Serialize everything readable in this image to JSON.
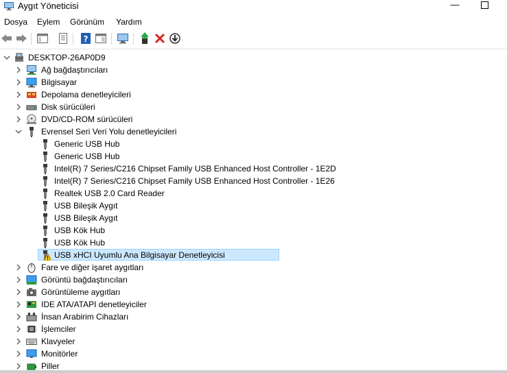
{
  "window": {
    "title": "Aygıt Yöneticisi",
    "minimize_glyph": "—"
  },
  "menu": [
    "Dosya",
    "Eylem",
    "Görünüm",
    "Yardım"
  ],
  "toolbar": {
    "icons": [
      "back-arrow-icon",
      "forward-arrow-icon",
      "show-hide-console-tree-icon",
      "properties-icon",
      "help-icon",
      "action-pane-icon",
      "scan-hardware-icon",
      "update-driver-icon",
      "uninstall-icon",
      "disable-device-icon"
    ]
  },
  "tree": {
    "root": "DESKTOP-26AP0D9",
    "categories_before": [
      {
        "label": "Ağ bağdaştırıcıları",
        "icon": "network-adapter-icon"
      },
      {
        "label": "Bilgisayar",
        "icon": "computer-icon"
      },
      {
        "label": "Depolama denetleyicileri",
        "icon": "storage-controller-icon"
      },
      {
        "label": "Disk sürücüleri",
        "icon": "disk-drive-icon"
      },
      {
        "label": "DVD/CD-ROM sürücüleri",
        "icon": "dvd-drive-icon"
      }
    ],
    "usb_category": {
      "label": "Evrensel Seri Veri Yolu denetleyicileri",
      "icon": "usb-icon",
      "children": [
        {
          "label": "Generic USB Hub",
          "warning": false
        },
        {
          "label": "Generic USB Hub",
          "warning": false
        },
        {
          "label": "Intel(R) 7 Series/C216 Chipset Family USB Enhanced Host Controller - 1E2D",
          "warning": false
        },
        {
          "label": "Intel(R) 7 Series/C216 Chipset Family USB Enhanced Host Controller - 1E26",
          "warning": false
        },
        {
          "label": "Realtek USB 2.0 Card Reader",
          "warning": false
        },
        {
          "label": "USB Bileşik Aygıt",
          "warning": false
        },
        {
          "label": "USB Bileşik Aygıt",
          "warning": false
        },
        {
          "label": "USB Kök Hub",
          "warning": false
        },
        {
          "label": "USB Kök Hub",
          "warning": false
        },
        {
          "label": "USB xHCI Uyumlu Ana Bilgisayar Denetleyicisi",
          "warning": true,
          "selected": true
        }
      ]
    },
    "categories_after": [
      {
        "label": "Fare ve diğer işaret aygıtları",
        "icon": "mouse-icon"
      },
      {
        "label": "Görüntü bağdaştırıcıları",
        "icon": "display-adapter-icon"
      },
      {
        "label": "Görüntüleme aygıtları",
        "icon": "imaging-device-icon"
      },
      {
        "label": "IDE ATA/ATAPI denetleyiciler",
        "icon": "ide-controller-icon"
      },
      {
        "label": "İnsan Arabirim Cihazları",
        "icon": "hid-icon"
      },
      {
        "label": "İşlemciler",
        "icon": "processor-icon"
      },
      {
        "label": "Klavyeler",
        "icon": "keyboard-icon"
      },
      {
        "label": "Monitörler",
        "icon": "monitor-icon"
      },
      {
        "label": "Piller",
        "icon": "battery-icon"
      }
    ]
  },
  "colors": {
    "selection_bg": "#cce8ff",
    "selection_border": "#99d1ff",
    "warning": "#f5c400",
    "uninstall_red": "#d9251d",
    "toolbar_blue": "#1e5fb4"
  }
}
